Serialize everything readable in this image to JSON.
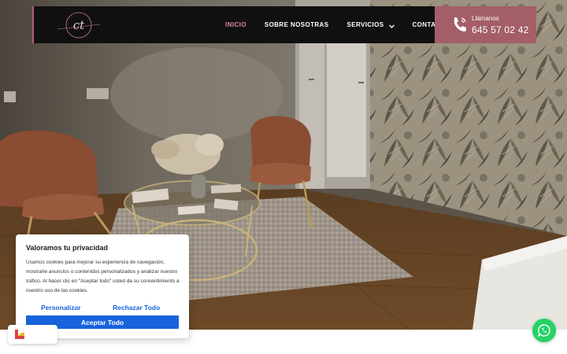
{
  "header": {
    "logo_text": "ct",
    "nav": [
      {
        "label": "INICIO",
        "active": true
      },
      {
        "label": "SOBRE NOSOTRAS",
        "active": false
      },
      {
        "label": "SERVICIOS",
        "active": false,
        "has_dropdown": true
      },
      {
        "label": "CONTACTO",
        "active": false
      }
    ],
    "call": {
      "label": "Llámanos",
      "number": "645 57 02 42",
      "icon": "phone-icon"
    }
  },
  "cookie_banner": {
    "title": "Valoramos tu privacidad",
    "text": "Usamos cookies para mejorar su experiencia de navegación, mostrarle anuncios o contenidos personalizados y analizar nuestro tráfico. Al hacer clic en \"Aceptar todo\" usted da su consentimiento a nuestro uso de las cookies.",
    "customize_label": "Personalizar",
    "reject_label": "Rechazar Todo",
    "accept_label": "Aceptar Todo",
    "accent_color": "#1863dc"
  },
  "widgets": {
    "revisit_icon": "cookie-consent-icon",
    "whatsapp_icon": "whatsapp-icon"
  },
  "colors": {
    "header_bg": "#111010",
    "call_box_bg": "#a45e67",
    "nav_active": "#d7869a",
    "whatsapp": "#25d366"
  }
}
